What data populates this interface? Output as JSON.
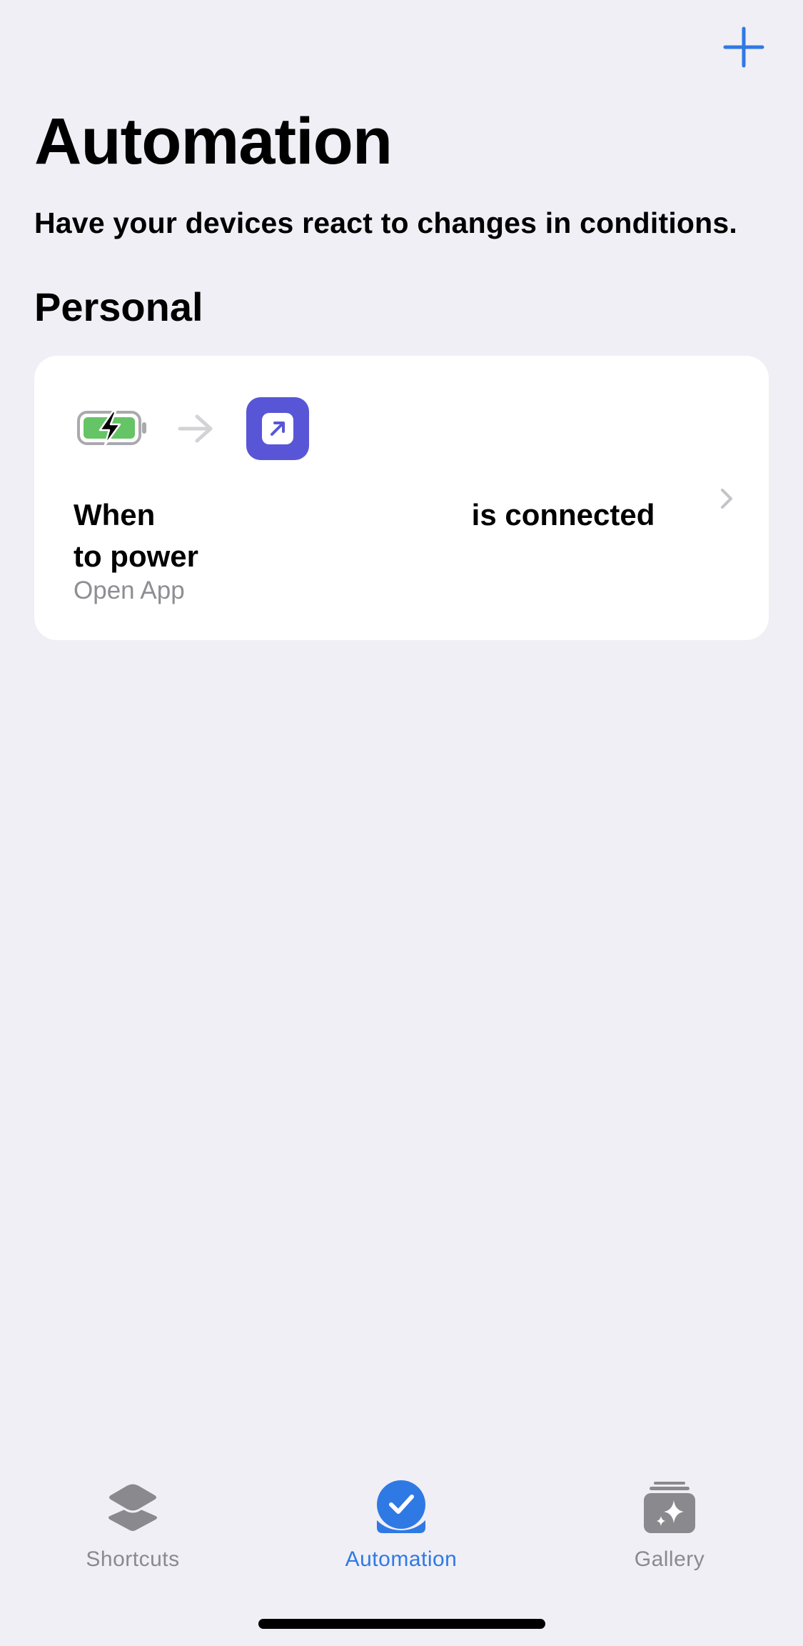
{
  "header": {
    "add_button_icon": "plus-icon",
    "title": "Automation",
    "subtitle": "Have your devices react to changes in conditions."
  },
  "section": {
    "title": "Personal"
  },
  "automations": [
    {
      "trigger_icon": "battery-charging-icon",
      "arrow_icon": "arrow-right-icon",
      "action_icon": "open-app-icon",
      "trigger_prefix": "When",
      "trigger_suffix": "is connected to power",
      "action": "Open App",
      "chevron_icon": "chevron-right-icon"
    }
  ],
  "tab_bar": {
    "tabs": [
      {
        "label": "Shortcuts",
        "icon": "stack-icon",
        "active": false
      },
      {
        "label": "Automation",
        "icon": "clock-check-icon",
        "active": true
      },
      {
        "label": "Gallery",
        "icon": "sparkles-icon",
        "active": false
      }
    ]
  },
  "colors": {
    "background": "#F0EFF5",
    "card": "#FFFFFF",
    "accent": "#2F79E4",
    "tab_inactive": "#8A8A8E",
    "app_tile": "#5856D6",
    "battery_fill": "#65C466",
    "secondary_text": "#8E8E93"
  }
}
